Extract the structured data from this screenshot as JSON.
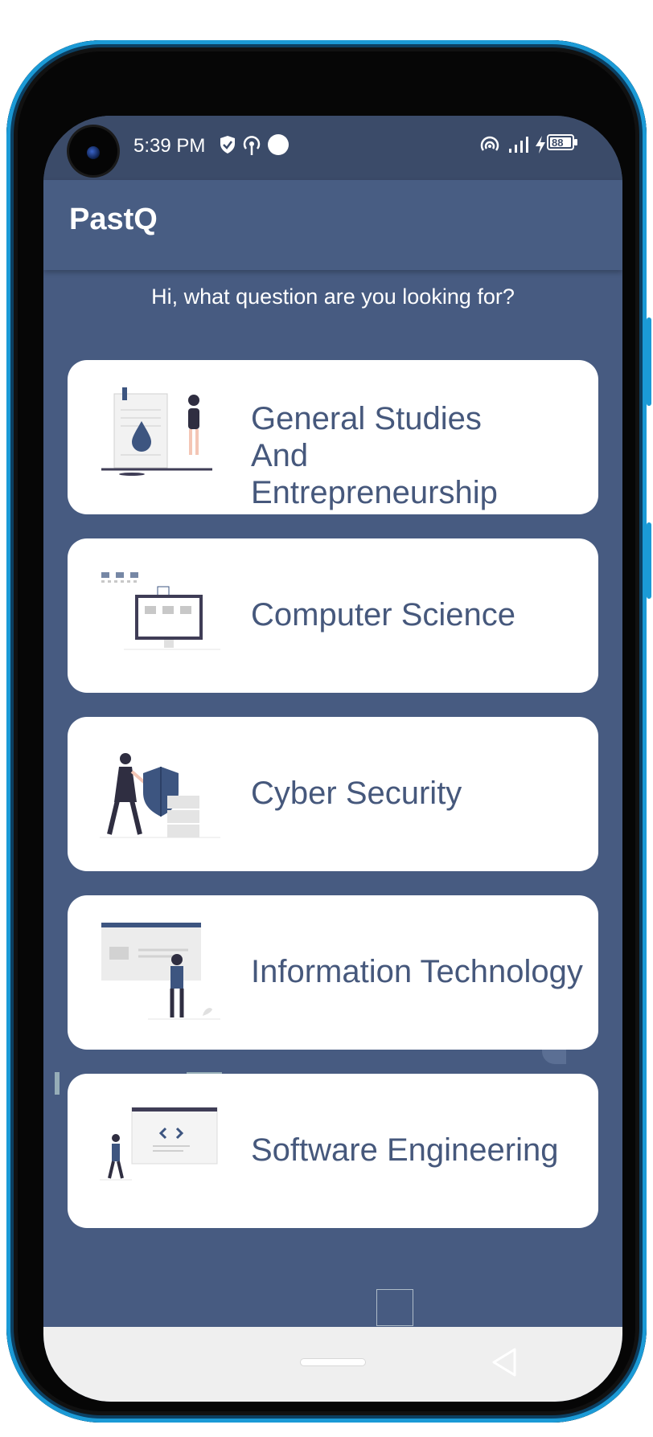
{
  "status": {
    "time": "5:39 PM",
    "battery": "88"
  },
  "app": {
    "title": "PastQ",
    "greeting": "Hi, what question are you looking for?"
  },
  "courses": [
    {
      "label": "General Studies And Entrepreneurship",
      "illustration": "document-drop-person-illustration"
    },
    {
      "label": "Computer Science",
      "illustration": "monitor-illustration"
    },
    {
      "label": "Cyber Security",
      "illustration": "shield-person-illustration"
    },
    {
      "label": "Information Technology",
      "illustration": "web-page-person-illustration"
    },
    {
      "label": "Software Engineering",
      "illustration": "code-window-person-illustration"
    }
  ],
  "colors": {
    "background": "#475b81",
    "status_bar": "#3b4b69",
    "card_text": "#46587c",
    "accent": "#3d5580"
  }
}
